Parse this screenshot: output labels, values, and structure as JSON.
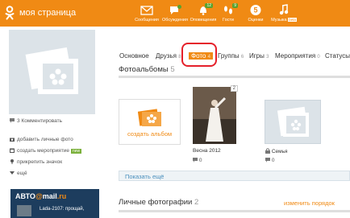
{
  "topbar": {
    "brand": "моя страница",
    "nav": [
      {
        "label": "Сообщения",
        "icon": "envelope-icon"
      },
      {
        "label": "Обсуждения",
        "icon": "chat-icon"
      },
      {
        "label": "Оповещения",
        "icon": "bell-icon",
        "badge": "12"
      },
      {
        "label": "Гости",
        "icon": "footprints-icon",
        "badge": "9"
      },
      {
        "label": "Оценки",
        "icon": "five-icon"
      },
      {
        "label": "Музыка",
        "icon": "music-icon",
        "badge": "beta"
      }
    ]
  },
  "sidebar": {
    "comments": "3 Комментировать",
    "actions": [
      {
        "label": "добавить личные фото",
        "icon": "camera-icon"
      },
      {
        "label": "создать мероприятие",
        "icon": "calendar-icon",
        "badge": "new"
      },
      {
        "label": "прикрепить значок",
        "icon": "pin-icon"
      },
      {
        "label": "ещё",
        "icon": "triangle-down-icon"
      }
    ],
    "promo": {
      "brand_prefix": "АВТО",
      "brand_at": "@",
      "brand_mail": "mail",
      "brand_domain": ".ru",
      "caption": "Lada-2107: прощай,"
    }
  },
  "tabs": [
    {
      "label": "Основное",
      "count": ""
    },
    {
      "label": "Друзья",
      "count": "8"
    },
    {
      "label": "Фото",
      "count": "4",
      "active": true
    },
    {
      "label": "Группы",
      "count": "6"
    },
    {
      "label": "Игры",
      "count": "3"
    },
    {
      "label": "Мероприятия",
      "count": "0"
    },
    {
      "label": "Статусы",
      "count": ""
    }
  ],
  "albums_section": {
    "title": "Фотоальбомы",
    "count": "5",
    "create_label": "создать альбом",
    "albums": [
      {
        "name": "Весна 2012",
        "photo_count": "2",
        "comments": "0"
      },
      {
        "name": "Семья",
        "comments": "0",
        "has_lock": true
      }
    ],
    "more_label": "Показать ещё"
  },
  "personal_section": {
    "title": "Личные фотографии",
    "count": "2",
    "change_order": "изменить порядок"
  },
  "colors": {
    "accent": "#f08a14",
    "highlight": "#e5202a",
    "link": "#4a8fbd"
  }
}
